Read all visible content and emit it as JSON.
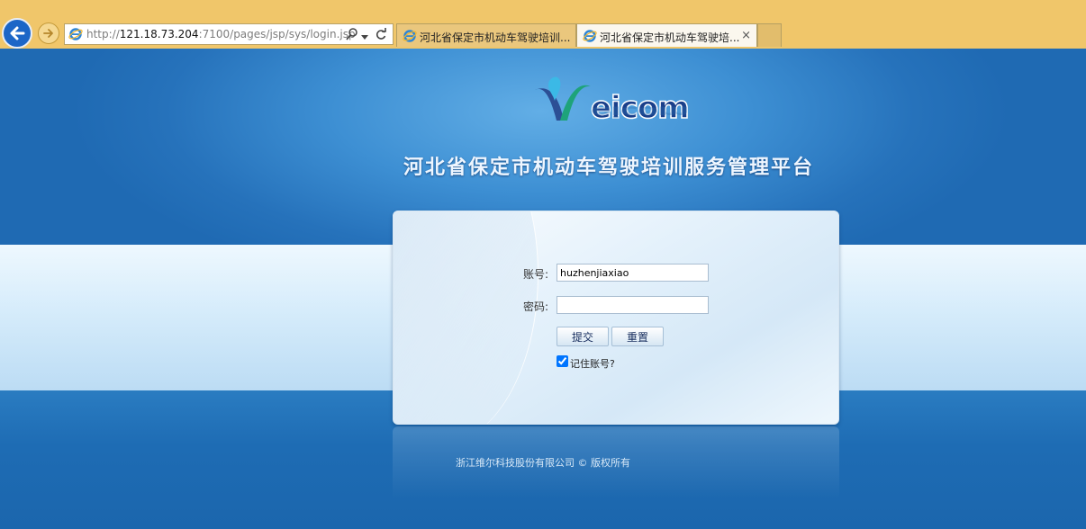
{
  "browser": {
    "url_prefix": "http://",
    "url_host": "121.18.73.204",
    "url_path": ":7100/pages/jsp/sys/login.jsp",
    "tabs": [
      {
        "label": "河北省保定市机动车驾驶培训...",
        "active": false
      },
      {
        "label": "河北省保定市机动车驾驶培...",
        "active": true,
        "close": "×"
      }
    ],
    "icons": [
      "back-icon",
      "forward-icon",
      "ie-icon",
      "search-icon",
      "dropdown-icon",
      "refresh-icon",
      "close-icon"
    ]
  },
  "header": {
    "logo_text": "eicom",
    "title": "河北省保定市机动车驾驶培训服务管理平台"
  },
  "login": {
    "account_label": "账号:",
    "account_value": "huzhenjiaxiao",
    "password_label": "密码:",
    "password_value": "",
    "submit_label": "提交",
    "reset_label": "重置",
    "remember_label": "记住账号?",
    "remember_checked": true
  },
  "footer": {
    "copyright": "浙江维尔科技股份有限公司 © 版权所有"
  },
  "colors": {
    "chrome_bg": "#f0c66a",
    "page_blue": "#1f6fb5",
    "title_color": "#eef6ff",
    "logo_color": "#1a3f8a"
  }
}
